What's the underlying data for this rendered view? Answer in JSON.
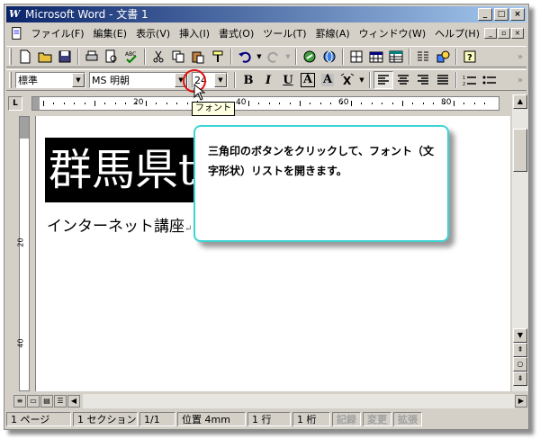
{
  "window": {
    "title": "Microsoft Word - 文書 1",
    "app_icon": "W"
  },
  "menu": {
    "items": [
      "ファイル(F)",
      "編集(E)",
      "表示(V)",
      "挿入(I)",
      "書式(O)",
      "ツール(T)",
      "罫線(A)",
      "ウィンドウ(W)",
      "ヘルプ(H)"
    ]
  },
  "format_toolbar": {
    "style_value": "標準",
    "font_value": "MS 明朝",
    "size_value": "24",
    "bold_label": "B",
    "italic_label": "I",
    "underline_label": "U",
    "border_char_label": "A",
    "shade_char_label": "A"
  },
  "ruler": {
    "labels": [
      "20",
      "40",
      "60",
      "80"
    ]
  },
  "vertical_ruler": {
    "labels": [
      "20",
      "40"
    ]
  },
  "document": {
    "heading_text": "群馬県t",
    "subline_text": "インターネット講座",
    "para_mark": "↵"
  },
  "tooltip": {
    "text": "フォント"
  },
  "callout": {
    "text": "三角印のボタンをクリックして、フォント（文字形状）リストを開きます。"
  },
  "status": {
    "page": "1 ページ",
    "section": "1 セクション",
    "page_of": "1/1",
    "position": "位置 4mm",
    "line": "1 行",
    "column": "1 桁",
    "rec": "記録",
    "trk": "変更",
    "ext": "拡張"
  },
  "colors": {
    "title_start": "#0a246a",
    "title_end": "#a6caf0",
    "callout_border": "#3fd4d4",
    "highlight_circle": "#e01010"
  }
}
